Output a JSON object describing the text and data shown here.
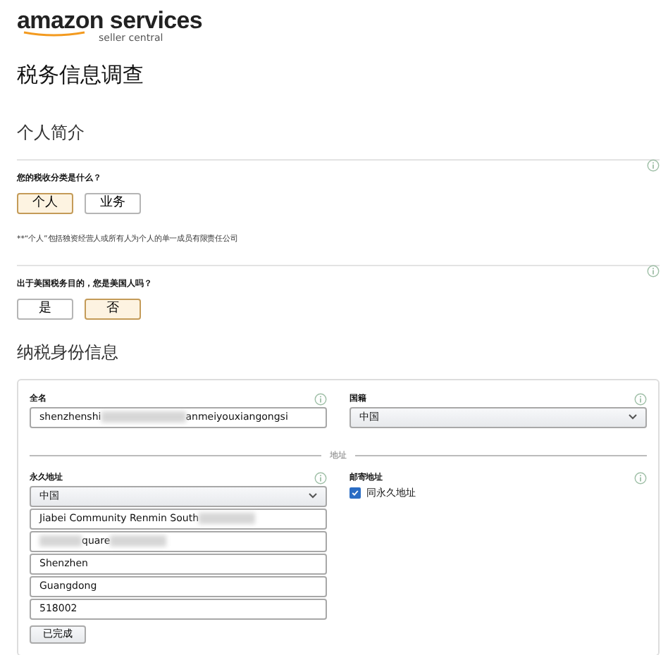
{
  "header": {
    "logo_text": "amazon services",
    "logo_subtext": "seller central"
  },
  "title": "税务信息调查",
  "profile": {
    "heading": "个人简介",
    "questions": [
      {
        "label": "您的税收分类是什么？",
        "options": [
          {
            "label": "个人",
            "selected": true
          },
          {
            "label": "业务",
            "selected": false
          }
        ],
        "note": "**“个人”包括独资经营人或所有人为个人的单一成员有限责任公司"
      },
      {
        "label": "出于美国税务目的，您是美国人吗？",
        "options": [
          {
            "label": "是",
            "selected": false
          },
          {
            "label": "否",
            "selected": true
          }
        ]
      }
    ]
  },
  "tax_identity": {
    "heading": "纳税身份信息",
    "full_name": {
      "label": "全名",
      "value_parts": [
        "shenzhenshi",
        "anmeiyouxiangongsi"
      ]
    },
    "nationality": {
      "label": "国籍",
      "value": "中国"
    },
    "divider_label": "地址",
    "permanent_address": {
      "label": "永久地址",
      "country": "中国",
      "lines": [
        {
          "value": "Jiabei Community Renmin South",
          "redacted_before": false,
          "redacted_after": true
        },
        {
          "value": "quare",
          "redacted_before": true,
          "redacted_after": true
        },
        {
          "value": "Shenzhen",
          "redacted_before": false,
          "redacted_after": false
        },
        {
          "value": "Guangdong",
          "redacted_before": false,
          "redacted_after": false
        },
        {
          "value": "518002",
          "redacted_before": false,
          "redacted_after": false
        }
      ],
      "button": "已完成"
    },
    "mailing_address": {
      "label": "邮寄地址",
      "same_as_permanent": {
        "label": "同永久地址",
        "checked": true
      }
    }
  }
}
